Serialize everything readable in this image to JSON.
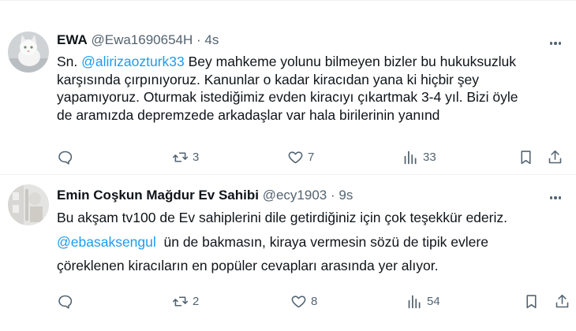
{
  "tweets": [
    {
      "name": "EWA",
      "handle": "@Ewa1690654H",
      "separator": "·",
      "time": "4s",
      "lines": [
        {
          "pre": "Sn. ",
          "mention": "@alirizaozturk33",
          "post": " Bey mahkeme yolunu bilmeyen bizler bu hukuksuzluk"
        },
        {
          "pre": "karşısında çırpınıyoruz. Kanunlar o kadar kiracıdan yana ki hiçbir şey",
          "mention": "",
          "post": ""
        },
        {
          "pre": "yapamıyoruz. Oturmak istediğimiz evden kiracıyı çıkartmak 3-4 yıl. Bizi öyle",
          "mention": "",
          "post": ""
        },
        {
          "pre": "de aramızda depremzede arkadaşlar var hala birilerinin yanınd",
          "mention": "",
          "post": ""
        }
      ],
      "actions": {
        "replies": "",
        "retweets": "3",
        "likes": "7",
        "views": "33"
      }
    },
    {
      "name": "Emin Coşkun Mağdur Ev Sahibi",
      "handle": "@ecy1903",
      "separator": "·",
      "time": "9s",
      "lines": [
        {
          "pre": "Bu akşam tv100 de Ev sahiplerini dile getirdiğiniz için çok teşekkür ederiz.",
          "mention": "",
          "post": ""
        },
        {
          "pre": "",
          "mention": "@ebasaksengul",
          "post": "  ün de bakmasın, kiraya vermesin sözü de tipik evlere"
        },
        {
          "pre": "çöreklenen kiracıların en popüler cevapları arasında yer alıyor.",
          "mention": "",
          "post": ""
        }
      ],
      "actions": {
        "replies": "",
        "retweets": "2",
        "likes": "8",
        "views": "54"
      }
    }
  ],
  "colors": {
    "text": "#0f1419",
    "secondary": "#536471",
    "link": "#1d9bf0",
    "divider": "#eff3f4"
  },
  "icons": [
    "more-icon",
    "reply-icon",
    "retweet-icon",
    "like-icon",
    "views-icon",
    "bookmark-icon",
    "share-icon"
  ]
}
